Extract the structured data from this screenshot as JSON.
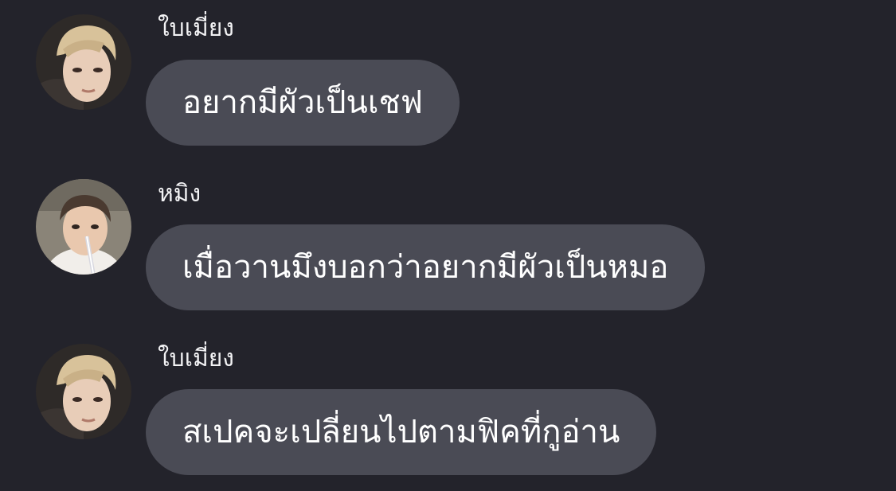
{
  "colors": {
    "background": "#23232b",
    "bubble": "#4a4b55",
    "text": "#ffffff"
  },
  "messages": [
    {
      "sender": "ใบเมี่ยง",
      "text": "อยากมีผัวเป็นเชฟ",
      "avatar": "profile-photo"
    },
    {
      "sender": "หมิง",
      "text": "เมื่อวานมึงบอกว่าอยากมีผัวเป็นหมอ",
      "avatar": "profile-photo"
    },
    {
      "sender": "ใบเมี่ยง",
      "text": "สเปคจะเปลี่ยนไปตามฟิคที่กูอ่าน",
      "avatar": "profile-photo"
    }
  ]
}
